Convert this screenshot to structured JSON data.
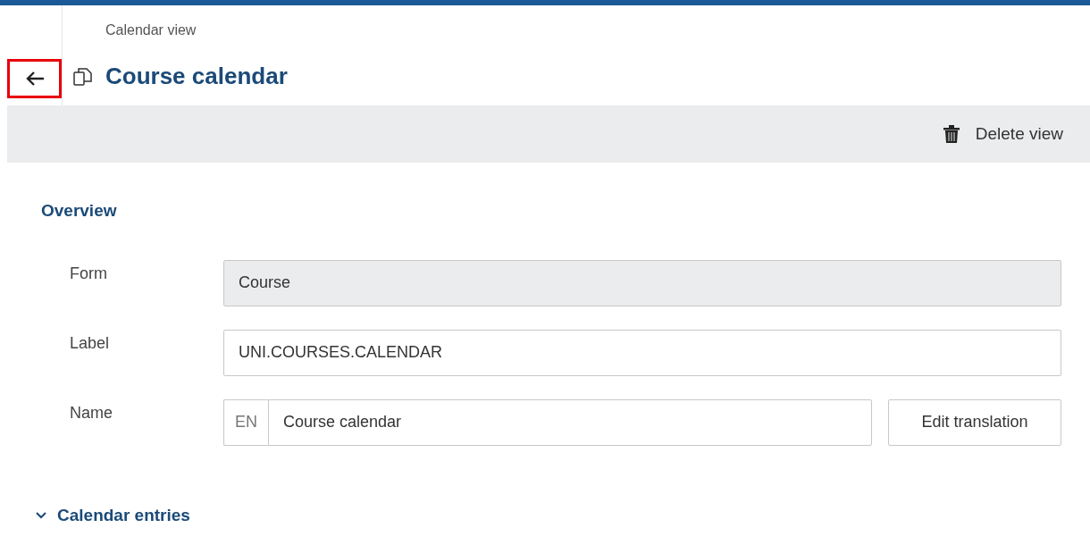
{
  "header": {
    "breadcrumb": "Calendar view",
    "title": "Course calendar",
    "back_button": {
      "highlighted": true
    }
  },
  "toolbar": {
    "actions": [
      {
        "label": "Delete view"
      }
    ]
  },
  "overview": {
    "heading": "Overview",
    "fields": [
      {
        "label": "Form",
        "kind": "readonly",
        "value": "Course"
      },
      {
        "label": "Label",
        "kind": "text",
        "value": "UNI.COURSES.CALENDAR"
      },
      {
        "label": "Name",
        "kind": "translated",
        "language": "EN",
        "value": "Course calendar",
        "button": "Edit translation"
      }
    ]
  },
  "sections": [
    {
      "title": "Calendar entries",
      "expanded": true
    }
  ]
}
